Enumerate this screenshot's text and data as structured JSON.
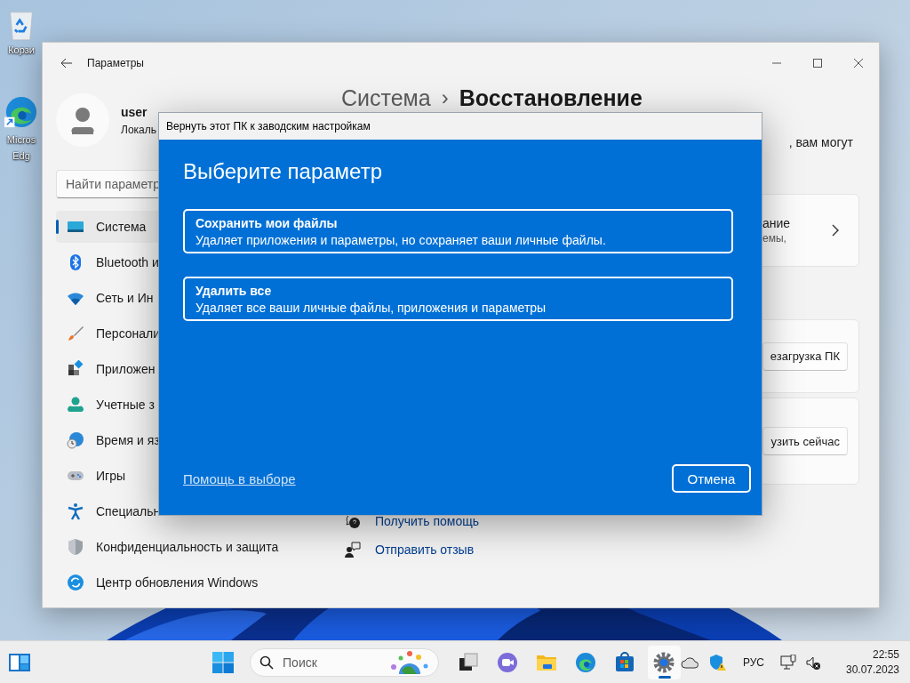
{
  "desktop_icons": [
    {
      "kind": "recycle",
      "label_lines": [
        "Корзи"
      ]
    },
    {
      "kind": "edge",
      "label_lines": [
        "Micros",
        "Edg"
      ]
    }
  ],
  "settings_window": {
    "title": "Параметры",
    "user": {
      "name": "user",
      "account": "Локаль"
    },
    "search": {
      "placeholder": "Найти параметр"
    },
    "nav_items": [
      {
        "kind": "system",
        "label": "Система",
        "selected": true
      },
      {
        "kind": "bluetooth",
        "label": "Bluetooth и",
        "selected": false
      },
      {
        "kind": "network",
        "label": "Сеть и Ин",
        "selected": false
      },
      {
        "kind": "personalization",
        "label": "Персонали",
        "selected": false
      },
      {
        "kind": "apps",
        "label": "Приложен",
        "selected": false
      },
      {
        "kind": "accounts",
        "label": "Учетные з",
        "selected": false
      },
      {
        "kind": "time",
        "label": "Время и яз",
        "selected": false
      },
      {
        "kind": "gaming",
        "label": "Игры",
        "selected": false
      },
      {
        "kind": "accessibility",
        "label": "Специальн",
        "selected": false
      },
      {
        "kind": "privacy",
        "label": "Конфиденциальность и защита",
        "selected": false
      },
      {
        "kind": "update",
        "label": "Центр обновления Windows",
        "selected": false
      }
    ],
    "breadcrumb": {
      "parent": "Система",
      "separator": "›",
      "current": "Восстановление"
    },
    "description": ", вам могут",
    "cards": [
      {
        "kind": "link",
        "title": "ание",
        "subtitle": "емы,"
      },
      {
        "kind": "button",
        "button": "езагрузка ПК"
      },
      {
        "kind": "button",
        "button": "узить сейчас"
      }
    ],
    "links": [
      {
        "kind": "help",
        "label": "Получить помощь"
      },
      {
        "kind": "feedback",
        "label": "Отправить отзыв"
      }
    ]
  },
  "dialog": {
    "title": "Вернуть этот ПК к заводским настройкам",
    "heading": "Выберите параметр",
    "options": [
      {
        "title": "Сохранить мои файлы",
        "description": "Удаляет приложения и параметры, но сохраняет ваши личные файлы."
      },
      {
        "title": "Удалить все",
        "description": "Удаляет все ваши личные файлы, приложения и параметры"
      }
    ],
    "help_link": "Помощь в выборе",
    "cancel": "Отмена"
  },
  "taskbar": {
    "search_placeholder": "Поиск",
    "apps": [
      {
        "kind": "taskview",
        "selected": false
      },
      {
        "kind": "meet",
        "selected": false
      },
      {
        "kind": "explorer",
        "selected": false
      },
      {
        "kind": "edge",
        "selected": false
      },
      {
        "kind": "store",
        "selected": false
      },
      {
        "kind": "settings",
        "selected": true
      }
    ],
    "language": "РУС",
    "time": "22:55",
    "date": "30.07.2023"
  }
}
